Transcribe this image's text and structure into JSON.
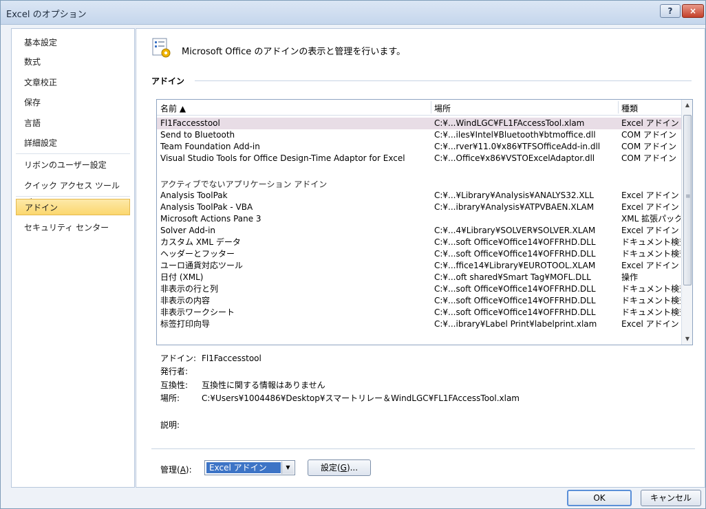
{
  "window": {
    "title": "Excel のオプション",
    "help": "?",
    "close": "×"
  },
  "sidebar": {
    "items": [
      {
        "label": "基本設定"
      },
      {
        "label": "数式"
      },
      {
        "label": "文章校正"
      },
      {
        "label": "保存"
      },
      {
        "label": "言語"
      },
      {
        "label": "詳細設定"
      },
      {
        "label": "リボンのユーザー設定"
      },
      {
        "label": "クイック アクセス ツール バー"
      },
      {
        "label": "アドイン"
      },
      {
        "label": "セキュリティ センター"
      }
    ],
    "active_index": 8
  },
  "header": {
    "text": "Microsoft Office のアドインの表示と管理を行います。"
  },
  "section": {
    "title": "アドイン"
  },
  "list": {
    "columns": {
      "name": "名前 ▲",
      "location": "場所",
      "type": "種類"
    },
    "active_rows": [
      {
        "name": "Fl1Faccesstool",
        "location": "C:¥...WindLGC¥FL1FAccessTool.xlam",
        "type": "Excel アドイン"
      },
      {
        "name": "Send to Bluetooth",
        "location": "C:¥...iles¥Intel¥Bluetooth¥btmoffice.dll",
        "type": "COM アドイン"
      },
      {
        "name": "Team Foundation Add-in",
        "location": "C:¥...rver¥11.0¥x86¥TFSOfficeAdd-in.dll",
        "type": "COM アドイン"
      },
      {
        "name": "Visual Studio Tools for Office Design-Time Adaptor for Excel",
        "location": "C:¥...Office¥x86¥VSTOExcelAdaptor.dll",
        "type": "COM アドイン"
      }
    ],
    "inactive_label": "アクティブでないアプリケーション アドイン",
    "inactive_rows": [
      {
        "name": "Analysis ToolPak",
        "location": "C:¥...¥Library¥Analysis¥ANALYS32.XLL",
        "type": "Excel アドイン"
      },
      {
        "name": "Analysis ToolPak - VBA",
        "location": "C:¥...ibrary¥Analysis¥ATPVBAEN.XLAM",
        "type": "Excel アドイン"
      },
      {
        "name": "Microsoft Actions Pane 3",
        "location": "",
        "type": "XML 拡張パック"
      },
      {
        "name": "Solver Add-in",
        "location": "C:¥...4¥Library¥SOLVER¥SOLVER.XLAM",
        "type": "Excel アドイン"
      },
      {
        "name": "カスタム XML データ",
        "location": "C:¥...soft Office¥Office14¥OFFRHD.DLL",
        "type": "ドキュメント検査"
      },
      {
        "name": "ヘッダーとフッター",
        "location": "C:¥...soft Office¥Office14¥OFFRHD.DLL",
        "type": "ドキュメント検査"
      },
      {
        "name": "ユーロ通貨対応ツール",
        "location": "C:¥...ffice14¥Library¥EUROTOOL.XLAM",
        "type": "Excel アドイン"
      },
      {
        "name": "日付 (XML)",
        "location": "C:¥...oft shared¥Smart Tag¥MOFL.DLL",
        "type": "操作"
      },
      {
        "name": "非表示の行と列",
        "location": "C:¥...soft Office¥Office14¥OFFRHD.DLL",
        "type": "ドキュメント検査"
      },
      {
        "name": "非表示の内容",
        "location": "C:¥...soft Office¥Office14¥OFFRHD.DLL",
        "type": "ドキュメント検査"
      },
      {
        "name": "非表示ワークシート",
        "location": "C:¥...soft Office¥Office14¥OFFRHD.DLL",
        "type": "ドキュメント検査"
      },
      {
        "name": "标签打印向导",
        "location": "C:¥...ibrary¥Label Print¥labelprint.xlam",
        "type": "Excel アドイン"
      }
    ]
  },
  "details": {
    "addin_label": "アドイン:",
    "addin_value": "Fl1Faccesstool",
    "publisher_label": "発行者:",
    "publisher_value": "",
    "compat_label": "互換性:",
    "compat_value": "互換性に関する情報はありません",
    "location_label": "場所:",
    "location_value": "C:¥Users¥1004486¥Desktop¥スマートリレー＆WindLGC¥FL1FAccessTool.xlam",
    "description_label": "説明:"
  },
  "manage": {
    "label_prefix": "管理(",
    "label_key": "A",
    "label_suffix": "):",
    "selected": "Excel アドイン",
    "settings_prefix": "設定(",
    "settings_key": "G",
    "settings_suffix": ")..."
  },
  "footer": {
    "ok": "OK",
    "cancel": "キャンセル"
  },
  "colors": {
    "accent": "#3d74c6",
    "active_nav": "#fbd76e",
    "selected_row": "#e8dde6"
  }
}
